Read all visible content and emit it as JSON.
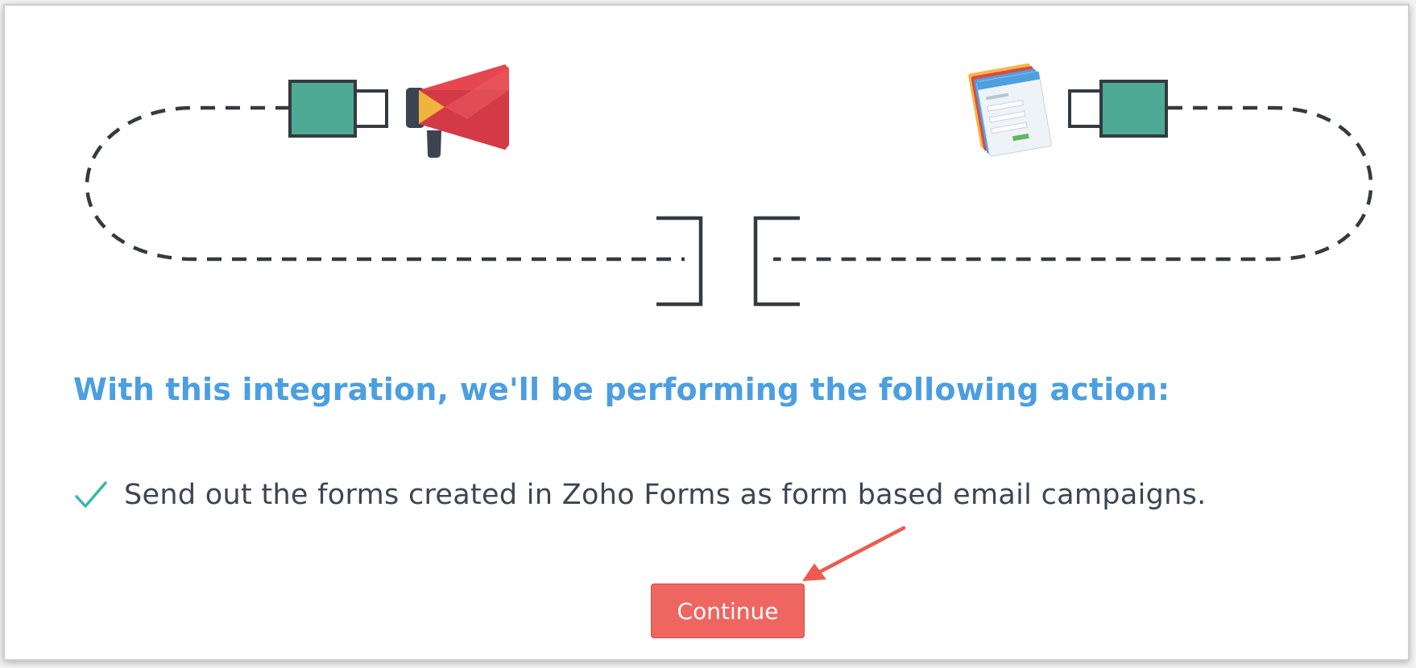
{
  "content": {
    "heading": "With this integration, we'll be performing the following action:",
    "actions": [
      {
        "text": "Send out the forms created in Zoho Forms as form based email campaigns.",
        "icon": "checkmark-icon"
      }
    ],
    "continue_label": "Continue"
  },
  "icons": {
    "left_app": "megaphone-icon",
    "right_app": "forms-icon",
    "left_plug": "plug-icon",
    "right_plug": "plug-icon",
    "connector": "socket-icon"
  },
  "colors": {
    "heading": "#4b9fe1",
    "text": "#3c4554",
    "check": "#3cb5a8",
    "button": "#ef6660",
    "plug": "#4ea995",
    "arrow": "#ee5a4f"
  }
}
